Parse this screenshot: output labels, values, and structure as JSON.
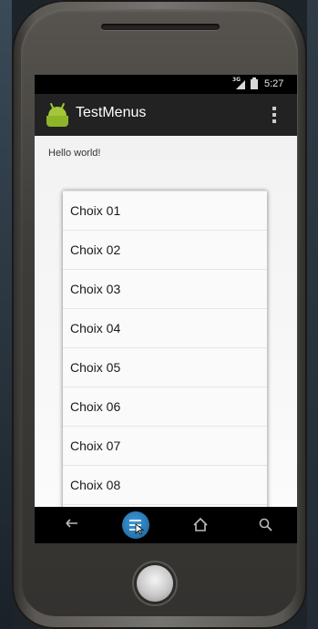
{
  "statusbar": {
    "network_label": "3G",
    "time": "5:27",
    "icons": [
      "signal-icon",
      "battery-icon"
    ]
  },
  "actionbar": {
    "app_title": "TestMenus",
    "icons": [
      "android-app-icon",
      "overflow-menu-icon"
    ]
  },
  "content": {
    "hello_text": "Hello world!"
  },
  "menu": {
    "items": [
      {
        "label": "Choix 01"
      },
      {
        "label": "Choix 02"
      },
      {
        "label": "Choix 03"
      },
      {
        "label": "Choix 04"
      },
      {
        "label": "Choix 05"
      },
      {
        "label": "Choix 06"
      },
      {
        "label": "Choix 07"
      },
      {
        "label": "Choix 08"
      }
    ]
  },
  "navbar": {
    "buttons": [
      "back-icon",
      "menu-icon",
      "home-icon",
      "search-icon"
    ]
  },
  "colors": {
    "actionbar_bg": "#222222",
    "accent_menu_button": "#2b7bbf",
    "android_green": "#a4c639"
  }
}
